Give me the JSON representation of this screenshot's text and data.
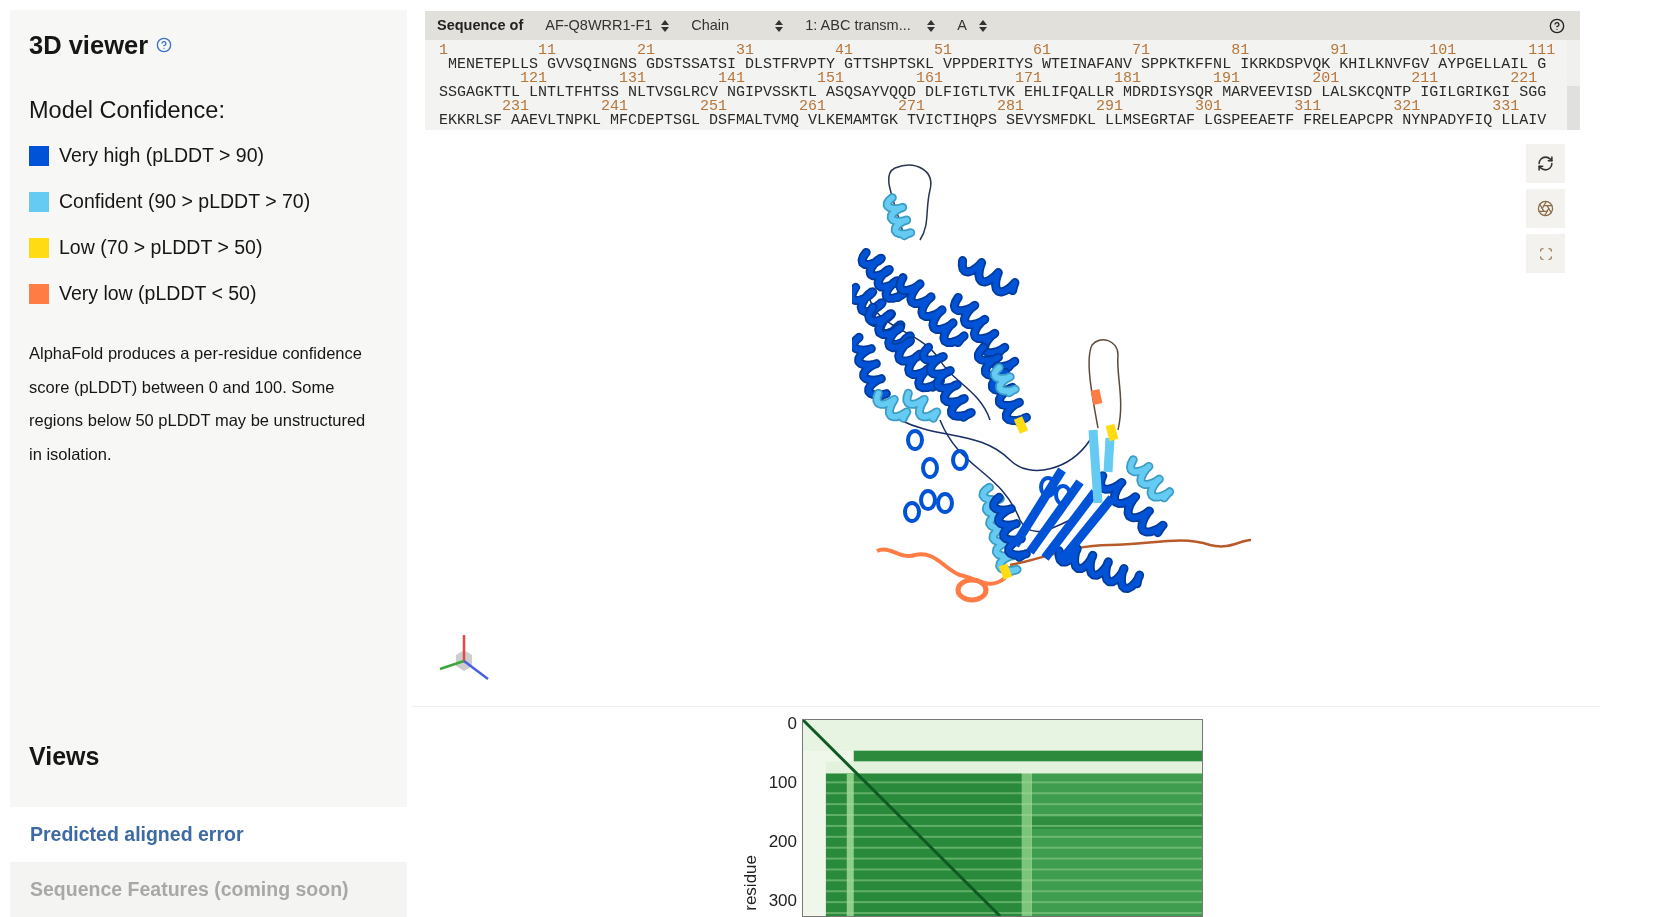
{
  "sidebar": {
    "title": "3D viewer",
    "legend_title": "Model Confidence:",
    "legend": [
      {
        "label": "Very high (pLDDT > 90)",
        "color": "#0053d6"
      },
      {
        "label": "Confident (90 > pLDDT > 70)",
        "color": "#65cbf3"
      },
      {
        "label": "Low (70 > pLDDT > 50)",
        "color": "#ffdb13"
      },
      {
        "label": "Very low (pLDDT < 50)",
        "color": "#ff7d45"
      }
    ],
    "description": "AlphaFold produces a per-residue confidence score (pLDDT) between 0 and 100. Some regions below 50 pLDDT may be unstructured in isolation.",
    "views_title": "Views",
    "views": [
      {
        "label": "Predicted aligned error",
        "disabled": false
      },
      {
        "label": "Sequence Features (coming soon)",
        "disabled": true
      }
    ]
  },
  "sequence_panel": {
    "label": "Sequence of",
    "selects": [
      {
        "value": "AF-Q8WRR1-F1"
      },
      {
        "value": "Chain"
      },
      {
        "value": "1: ABC transm..."
      },
      {
        "value": "A"
      }
    ],
    "rows": [
      {
        "numbers": [
          "1",
          "11",
          "21",
          "31",
          "41",
          "51",
          "61",
          "71",
          "81",
          "91",
          "101",
          "111"
        ],
        "sequence": "MENETEPLLS GVVSQINGNS GDSTSSATSI DLSTFRVPTY GTTSHPTSKL VPPDERITYS WTEINAFANV SPPKTKFFNL IKRKDSPVQK KHILKNVFGV AYPGELLAIL G"
      },
      {
        "numbers": [
          "121",
          "131",
          "141",
          "151",
          "161",
          "171",
          "181",
          "191",
          "201",
          "211",
          "221"
        ],
        "sequence": "SSGAGKTTL LNTLTFHTSS NLTVSGLRCV NGIPVSSKTL ASQSAYVQQD DLFIGTLTVK EHLIFQALLR MDRDISYSQR MARVEEVISD LALSKCQNTP IGILGRIKGI SGG"
      },
      {
        "numbers": [
          "231",
          "241",
          "251",
          "261",
          "271",
          "281",
          "291",
          "301",
          "311",
          "321",
          "331"
        ],
        "sequence": "EKKRLSF AAEVLTNPKL MFCDEPTSGL DSFMALTVMQ VLKEMAMTGK TVICTIHQPS SEVYSMFDKL LLMSEGRTAF LGSPEEAETF FRELEAPCPR NYNPADYFIQ LLAIV"
      }
    ]
  },
  "pae_plot": {
    "yticks": [
      "0",
      "100",
      "200",
      "300"
    ],
    "ylabel": "residue"
  }
}
